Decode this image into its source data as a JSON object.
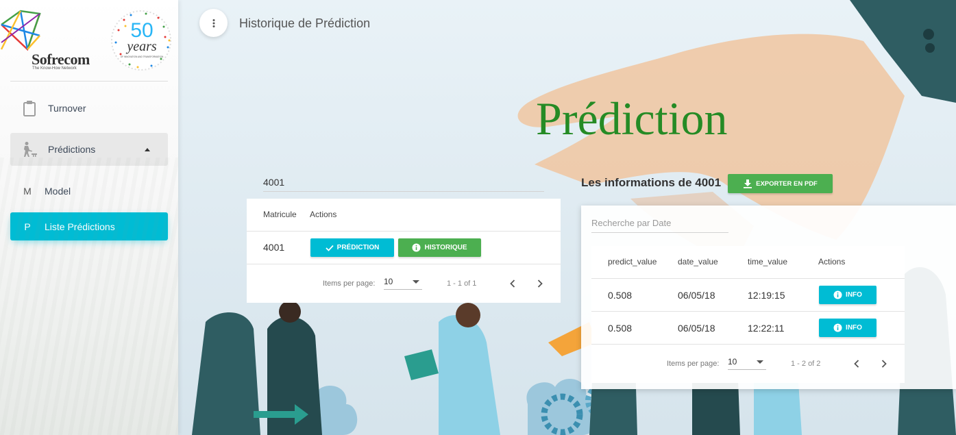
{
  "header": {
    "title": "Historique de Prédiction"
  },
  "sidebar": {
    "brand": {
      "name": "Sofrecom",
      "tagline": "The Know-How Network",
      "badge_number": "50",
      "badge_word": "years",
      "badge_sub": "OF INNOVATION AND TRANSFORMATION"
    },
    "items": [
      {
        "label": "Turnover",
        "icon": "clipboard-icon"
      },
      {
        "label": "Prédictions",
        "icon": "person-icon"
      },
      {
        "label": "Model",
        "abbr": "M"
      },
      {
        "label": "Liste Prédictions",
        "abbr": "P"
      }
    ]
  },
  "main": {
    "big_title": "Prédiction",
    "search_value": "4001",
    "table": {
      "columns": [
        "Matricule",
        "Actions"
      ],
      "rows": [
        {
          "matricule": "4001",
          "predict_label": "PRÉDICTION",
          "history_label": "HISTORIQUE"
        }
      ],
      "paginator": {
        "items_label": "Items per page:",
        "page_size": "10",
        "range": "1 - 1 of 1"
      }
    }
  },
  "details": {
    "heading": "Les informations de 4001",
    "export_label": "EXPORTER EN PDF",
    "date_placeholder": "Recherche par Date",
    "table": {
      "columns": [
        "predict_value",
        "date_value",
        "time_value",
        "Actions"
      ],
      "rows": [
        {
          "predict_value": "0.508",
          "date_value": "06/05/18",
          "time_value": "12:19:15",
          "action": "INFO"
        },
        {
          "predict_value": "0.508",
          "date_value": "06/05/18",
          "time_value": "12:22:11",
          "action": "INFO"
        }
      ],
      "paginator": {
        "items_label": "Items per page:",
        "page_size": "10",
        "range": "1 - 2 of 2"
      }
    }
  },
  "colors": {
    "accent": "#00bcd4",
    "success": "#4caf50",
    "title_green": "#258b25"
  }
}
